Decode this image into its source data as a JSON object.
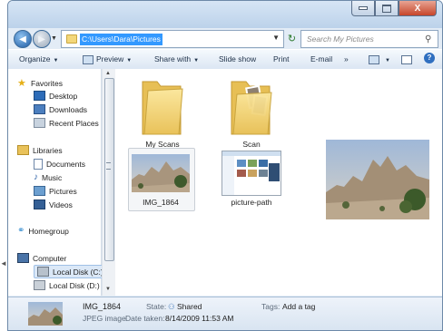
{
  "window": {
    "address_path": "C:\\Users\\Dara\\Pictures",
    "search_placeholder": "Search My Pictures",
    "close_glyph": "X"
  },
  "toolbar": {
    "organize": "Organize",
    "preview": "Preview",
    "share_with": "Share with",
    "slide_show": "Slide show",
    "print": "Print",
    "email": "E-mail",
    "more": "»"
  },
  "nav": {
    "favorites": "Favorites",
    "desktop": "Desktop",
    "downloads": "Downloads",
    "recent_places": "Recent Places",
    "libraries": "Libraries",
    "documents": "Documents",
    "music": "Music",
    "pictures": "Pictures",
    "videos": "Videos",
    "homegroup": "Homegroup",
    "computer": "Computer",
    "local_disk_c": "Local Disk (C:)",
    "local_disk_d": "Local Disk (D:)"
  },
  "items": {
    "my_scans": "My Scans",
    "scan": "Scan",
    "img_1864": "IMG_1864",
    "picture_path": "picture-path"
  },
  "details": {
    "name": "IMG_1864",
    "type": "JPEG image",
    "state_label": "State:",
    "state_value": "Shared",
    "date_label": "Date taken:",
    "date_value": "8/14/2009 11:53 AM",
    "tags_label": "Tags:",
    "tags_value": "Add a tag"
  },
  "colors": {
    "selection": "#3399ff",
    "folder": "#f3d77a",
    "chrome": "#e3ecf6"
  }
}
